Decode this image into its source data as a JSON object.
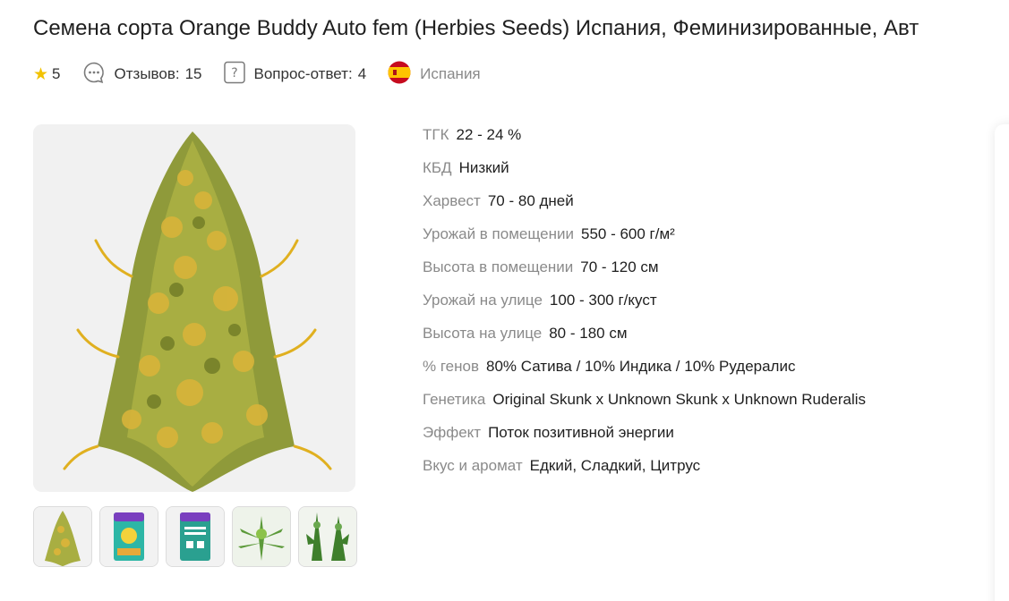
{
  "product": {
    "title": "Семена сорта Orange Buddy Auto fem (Herbies Seeds) Испания, Феминизированные, Авт"
  },
  "meta": {
    "rating": "5",
    "reviews_label": "Отзывов:",
    "reviews_count": "15",
    "qa_label": "Вопрос-ответ:",
    "qa_count": "4",
    "country": "Испания"
  },
  "icons": {
    "rating": "star-icon",
    "reviews": "chat-bubble-icon",
    "qa": "question-box-icon",
    "country": "spain-flag-icon"
  },
  "gallery": {
    "thumbnails": [
      "plant-bud",
      "seed-pack",
      "seed-pack-back",
      "plant-leaves",
      "plant-field"
    ]
  },
  "specs": [
    {
      "label": "ТГК",
      "value": "22 - 24 %"
    },
    {
      "label": "КБД",
      "value": "Низкий"
    },
    {
      "label": "Харвест",
      "value": "70 - 80 дней"
    },
    {
      "label": "Урожай в помещении",
      "value": "550 - 600 г/м²"
    },
    {
      "label": "Высота в помещении",
      "value": "70 - 120 см"
    },
    {
      "label": "Урожай на улице",
      "value": "100 - 300 г/куст"
    },
    {
      "label": "Высота на улице",
      "value": "80 - 180 см"
    },
    {
      "label": "% генов",
      "value": "80% Сатива / 10% Индика / 10% Рудералис"
    },
    {
      "label": "Генетика",
      "value": "Original Skunk x Unknown Skunk x Unknown Ruderalis"
    },
    {
      "label": "Эффект",
      "value": "Поток позитивной энергии"
    },
    {
      "label": "Вкус и аромат",
      "value": "Едкий, Сладкий, Цитрус"
    }
  ],
  "colors": {
    "label_gray": "#8a8a8a",
    "star": "#f2c200",
    "gallery_bg": "#f1f1f1"
  }
}
